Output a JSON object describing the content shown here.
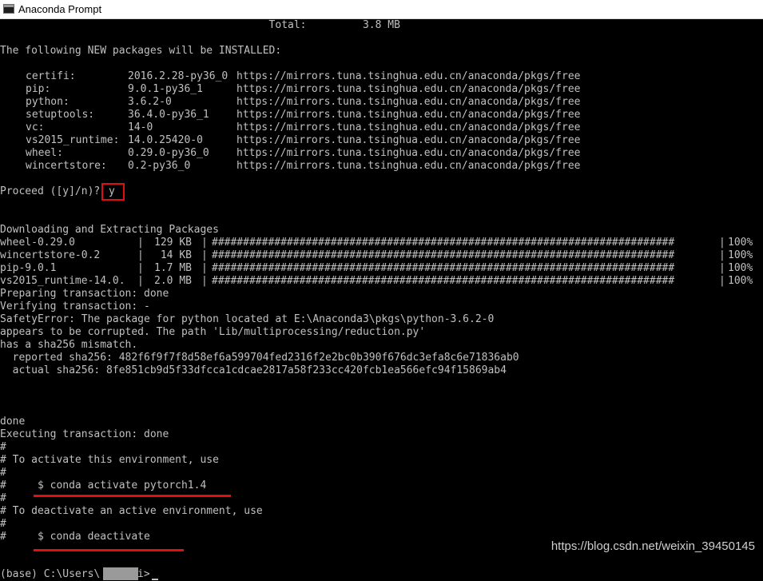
{
  "window": {
    "title": "Anaconda Prompt",
    "icon": "console-icon"
  },
  "header_lines": {
    "total": "                                           Total:         3.8 MB",
    "new_packages": "The following NEW packages will be INSTALLED:"
  },
  "packages": [
    {
      "name": "certifi:",
      "version": "2016.2.28-py36_0",
      "url": "https://mirrors.tuna.tsinghua.edu.cn/anaconda/pkgs/free"
    },
    {
      "name": "pip:",
      "version": "9.0.1-py36_1",
      "url": "https://mirrors.tuna.tsinghua.edu.cn/anaconda/pkgs/free"
    },
    {
      "name": "python:",
      "version": "3.6.2-0",
      "url": "https://mirrors.tuna.tsinghua.edu.cn/anaconda/pkgs/free"
    },
    {
      "name": "setuptools:",
      "version": "36.4.0-py36_1",
      "url": "https://mirrors.tuna.tsinghua.edu.cn/anaconda/pkgs/free"
    },
    {
      "name": "vc:",
      "version": "14-0",
      "url": "https://mirrors.tuna.tsinghua.edu.cn/anaconda/pkgs/free"
    },
    {
      "name": "vs2015_runtime:",
      "version": "14.0.25420-0",
      "url": "https://mirrors.tuna.tsinghua.edu.cn/anaconda/pkgs/free"
    },
    {
      "name": "wheel:",
      "version": "0.29.0-py36_0",
      "url": "https://mirrors.tuna.tsinghua.edu.cn/anaconda/pkgs/free"
    },
    {
      "name": "wincertstore:",
      "version": "0.2-py36_0",
      "url": "https://mirrors.tuna.tsinghua.edu.cn/anaconda/pkgs/free"
    }
  ],
  "proceed": {
    "prompt": "Proceed ([y]/n)?",
    "answer": "y"
  },
  "downloading_title": "Downloading and Extracting Packages",
  "downloads": [
    {
      "name": "wheel-0.29.0",
      "size": "129 KB",
      "bar": "##########################################################################",
      "percent": "100%"
    },
    {
      "name": "wincertstore-0.2",
      "size": "14 KB",
      "bar": "##########################################################################",
      "percent": "100%"
    },
    {
      "name": "pip-9.0.1",
      "size": "1.7 MB",
      "bar": "##########################################################################",
      "percent": "100%"
    },
    {
      "name": "vs2015_runtime-14.0.",
      "size": "2.0 MB",
      "bar": "##########################################################################",
      "percent": "100%"
    }
  ],
  "separator": "|",
  "log_lines": [
    "Preparing transaction: done",
    "Verifying transaction: -",
    "SafetyError: The package for python located at E:\\Anaconda3\\pkgs\\python-3.6.2-0",
    "appears to be corrupted. The path 'Lib/multiprocessing/reduction.py'",
    "has a sha256 mismatch.",
    "  reported sha256: 482f6f9f7f8d58ef6a599704fed2316f2e2bc0b390f676dc3efa8c6e71836ab0",
    "  actual sha256: 8fe851cb9d5f33dfcca1cdcae2817a58f233cc420fcb1ea566efc94f15869ab4"
  ],
  "final_lines": [
    "done",
    "Executing transaction: done",
    "#",
    "# To activate this environment, use",
    "#",
    "#     $ conda activate pytorch1.4",
    "#",
    "# To deactivate an active environment, use",
    "#",
    "#     $ conda deactivate"
  ],
  "prompt": {
    "prefix": "(base) C:\\Users\\",
    "suffix": "i>"
  },
  "watermark": "https://blog.csdn.net/weixin_39450145",
  "colors": {
    "console_bg": "#000000",
    "console_fg": "#c0c0c0",
    "highlight": "#e01010",
    "titlebar_bg": "#ffffff"
  }
}
